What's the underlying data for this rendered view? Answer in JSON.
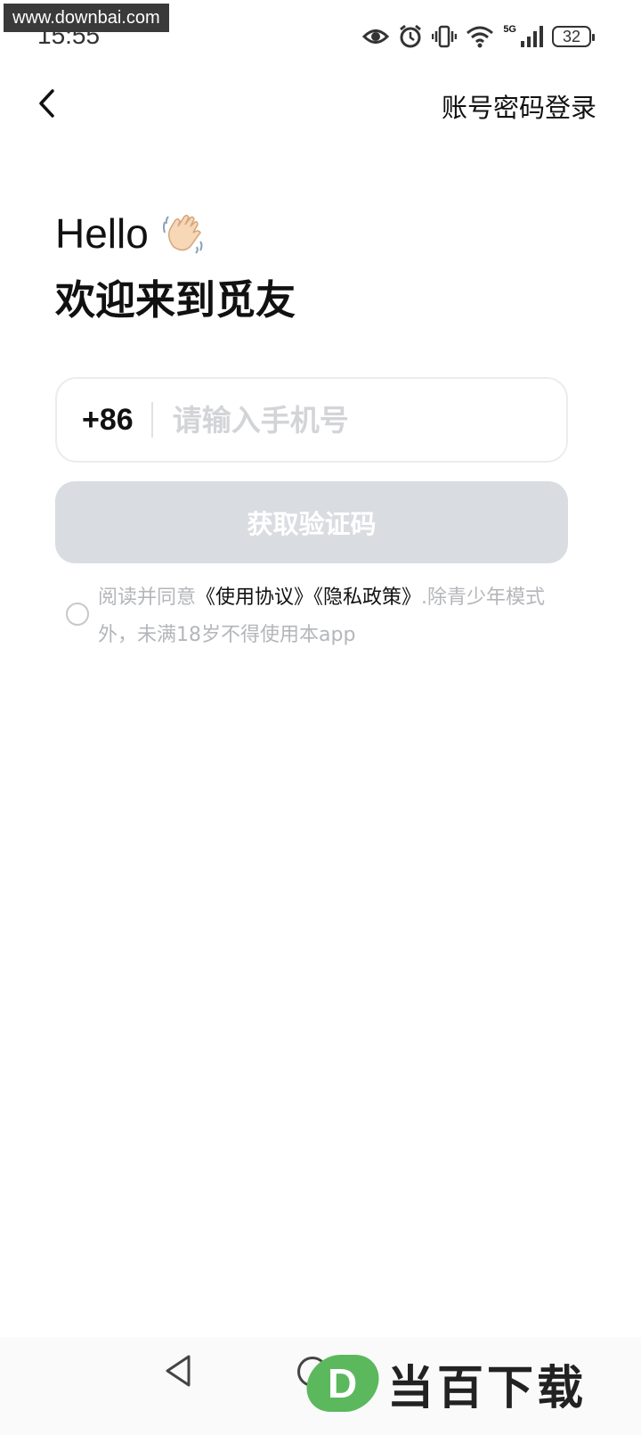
{
  "watermark": {
    "url": "www.downbai.com"
  },
  "status_bar": {
    "time": "15:55",
    "network": "5G",
    "battery": "32",
    "icons": [
      "eye-icon",
      "alarm-icon",
      "vibrate-icon",
      "wifi-icon",
      "signal-icon",
      "battery-icon"
    ]
  },
  "nav": {
    "back_icon": "chevron-left-icon",
    "password_login_label": "账号密码登录"
  },
  "greeting": {
    "hello": "Hello",
    "hello_icon": "waving-hand-icon",
    "welcome": "欢迎来到觅友"
  },
  "phone": {
    "country_code": "+86",
    "placeholder": "请输入手机号",
    "value": ""
  },
  "get_code_button": {
    "label": "获取验证码"
  },
  "agreement": {
    "checked": false,
    "prefix": "阅读并同意",
    "terms_link": "《使用协议》",
    "privacy_link": "《隐私政策》",
    "suffix": ".除青少年模式外，未满18岁不得使用本app"
  },
  "bottom_nav": {
    "icons": [
      "nav-back-icon",
      "nav-home-icon"
    ]
  },
  "site_logo": {
    "letter": "D",
    "text": "当百下载"
  },
  "colors": {
    "background": "#ffffff",
    "button_disabled": "#d9dce0",
    "placeholder": "#d3d4d7",
    "muted_text": "#b4b6ba",
    "logo_green": "#5cb85c"
  }
}
